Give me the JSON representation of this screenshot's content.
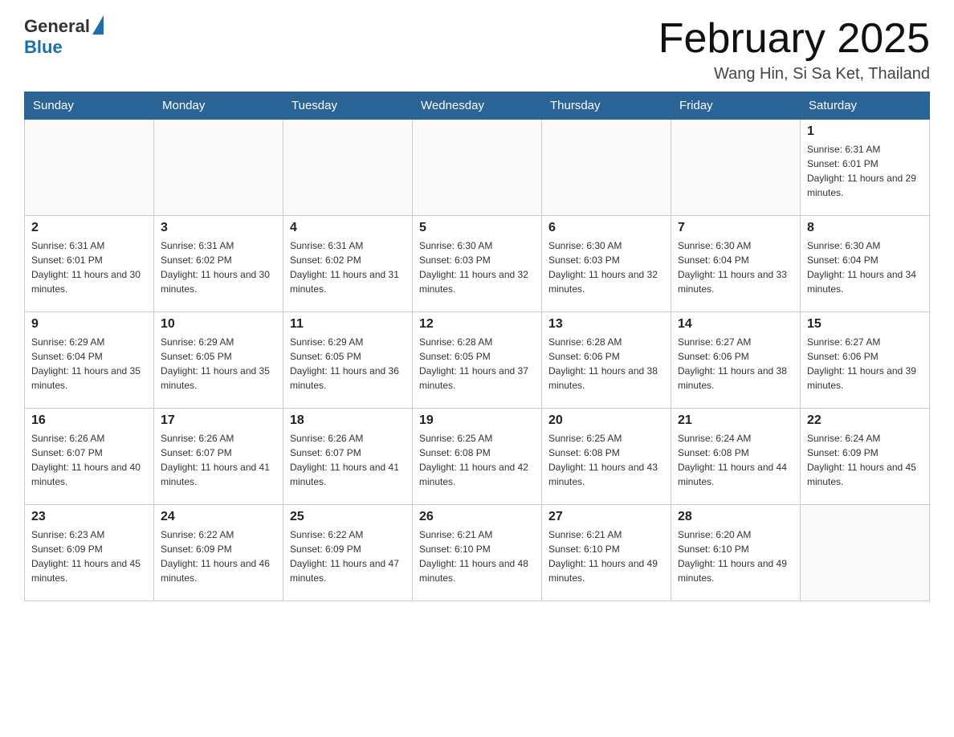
{
  "header": {
    "logo_general": "General",
    "logo_blue": "Blue",
    "month_title": "February 2025",
    "location": "Wang Hin, Si Sa Ket, Thailand"
  },
  "days_of_week": [
    "Sunday",
    "Monday",
    "Tuesday",
    "Wednesday",
    "Thursday",
    "Friday",
    "Saturday"
  ],
  "weeks": [
    [
      {
        "day": "",
        "sunrise": "",
        "sunset": "",
        "daylight": ""
      },
      {
        "day": "",
        "sunrise": "",
        "sunset": "",
        "daylight": ""
      },
      {
        "day": "",
        "sunrise": "",
        "sunset": "",
        "daylight": ""
      },
      {
        "day": "",
        "sunrise": "",
        "sunset": "",
        "daylight": ""
      },
      {
        "day": "",
        "sunrise": "",
        "sunset": "",
        "daylight": ""
      },
      {
        "day": "",
        "sunrise": "",
        "sunset": "",
        "daylight": ""
      },
      {
        "day": "1",
        "sunrise": "Sunrise: 6:31 AM",
        "sunset": "Sunset: 6:01 PM",
        "daylight": "Daylight: 11 hours and 29 minutes."
      }
    ],
    [
      {
        "day": "2",
        "sunrise": "Sunrise: 6:31 AM",
        "sunset": "Sunset: 6:01 PM",
        "daylight": "Daylight: 11 hours and 30 minutes."
      },
      {
        "day": "3",
        "sunrise": "Sunrise: 6:31 AM",
        "sunset": "Sunset: 6:02 PM",
        "daylight": "Daylight: 11 hours and 30 minutes."
      },
      {
        "day": "4",
        "sunrise": "Sunrise: 6:31 AM",
        "sunset": "Sunset: 6:02 PM",
        "daylight": "Daylight: 11 hours and 31 minutes."
      },
      {
        "day": "5",
        "sunrise": "Sunrise: 6:30 AM",
        "sunset": "Sunset: 6:03 PM",
        "daylight": "Daylight: 11 hours and 32 minutes."
      },
      {
        "day": "6",
        "sunrise": "Sunrise: 6:30 AM",
        "sunset": "Sunset: 6:03 PM",
        "daylight": "Daylight: 11 hours and 32 minutes."
      },
      {
        "day": "7",
        "sunrise": "Sunrise: 6:30 AM",
        "sunset": "Sunset: 6:04 PM",
        "daylight": "Daylight: 11 hours and 33 minutes."
      },
      {
        "day": "8",
        "sunrise": "Sunrise: 6:30 AM",
        "sunset": "Sunset: 6:04 PM",
        "daylight": "Daylight: 11 hours and 34 minutes."
      }
    ],
    [
      {
        "day": "9",
        "sunrise": "Sunrise: 6:29 AM",
        "sunset": "Sunset: 6:04 PM",
        "daylight": "Daylight: 11 hours and 35 minutes."
      },
      {
        "day": "10",
        "sunrise": "Sunrise: 6:29 AM",
        "sunset": "Sunset: 6:05 PM",
        "daylight": "Daylight: 11 hours and 35 minutes."
      },
      {
        "day": "11",
        "sunrise": "Sunrise: 6:29 AM",
        "sunset": "Sunset: 6:05 PM",
        "daylight": "Daylight: 11 hours and 36 minutes."
      },
      {
        "day": "12",
        "sunrise": "Sunrise: 6:28 AM",
        "sunset": "Sunset: 6:05 PM",
        "daylight": "Daylight: 11 hours and 37 minutes."
      },
      {
        "day": "13",
        "sunrise": "Sunrise: 6:28 AM",
        "sunset": "Sunset: 6:06 PM",
        "daylight": "Daylight: 11 hours and 38 minutes."
      },
      {
        "day": "14",
        "sunrise": "Sunrise: 6:27 AM",
        "sunset": "Sunset: 6:06 PM",
        "daylight": "Daylight: 11 hours and 38 minutes."
      },
      {
        "day": "15",
        "sunrise": "Sunrise: 6:27 AM",
        "sunset": "Sunset: 6:06 PM",
        "daylight": "Daylight: 11 hours and 39 minutes."
      }
    ],
    [
      {
        "day": "16",
        "sunrise": "Sunrise: 6:26 AM",
        "sunset": "Sunset: 6:07 PM",
        "daylight": "Daylight: 11 hours and 40 minutes."
      },
      {
        "day": "17",
        "sunrise": "Sunrise: 6:26 AM",
        "sunset": "Sunset: 6:07 PM",
        "daylight": "Daylight: 11 hours and 41 minutes."
      },
      {
        "day": "18",
        "sunrise": "Sunrise: 6:26 AM",
        "sunset": "Sunset: 6:07 PM",
        "daylight": "Daylight: 11 hours and 41 minutes."
      },
      {
        "day": "19",
        "sunrise": "Sunrise: 6:25 AM",
        "sunset": "Sunset: 6:08 PM",
        "daylight": "Daylight: 11 hours and 42 minutes."
      },
      {
        "day": "20",
        "sunrise": "Sunrise: 6:25 AM",
        "sunset": "Sunset: 6:08 PM",
        "daylight": "Daylight: 11 hours and 43 minutes."
      },
      {
        "day": "21",
        "sunrise": "Sunrise: 6:24 AM",
        "sunset": "Sunset: 6:08 PM",
        "daylight": "Daylight: 11 hours and 44 minutes."
      },
      {
        "day": "22",
        "sunrise": "Sunrise: 6:24 AM",
        "sunset": "Sunset: 6:09 PM",
        "daylight": "Daylight: 11 hours and 45 minutes."
      }
    ],
    [
      {
        "day": "23",
        "sunrise": "Sunrise: 6:23 AM",
        "sunset": "Sunset: 6:09 PM",
        "daylight": "Daylight: 11 hours and 45 minutes."
      },
      {
        "day": "24",
        "sunrise": "Sunrise: 6:22 AM",
        "sunset": "Sunset: 6:09 PM",
        "daylight": "Daylight: 11 hours and 46 minutes."
      },
      {
        "day": "25",
        "sunrise": "Sunrise: 6:22 AM",
        "sunset": "Sunset: 6:09 PM",
        "daylight": "Daylight: 11 hours and 47 minutes."
      },
      {
        "day": "26",
        "sunrise": "Sunrise: 6:21 AM",
        "sunset": "Sunset: 6:10 PM",
        "daylight": "Daylight: 11 hours and 48 minutes."
      },
      {
        "day": "27",
        "sunrise": "Sunrise: 6:21 AM",
        "sunset": "Sunset: 6:10 PM",
        "daylight": "Daylight: 11 hours and 49 minutes."
      },
      {
        "day": "28",
        "sunrise": "Sunrise: 6:20 AM",
        "sunset": "Sunset: 6:10 PM",
        "daylight": "Daylight: 11 hours and 49 minutes."
      },
      {
        "day": "",
        "sunrise": "",
        "sunset": "",
        "daylight": ""
      }
    ]
  ]
}
